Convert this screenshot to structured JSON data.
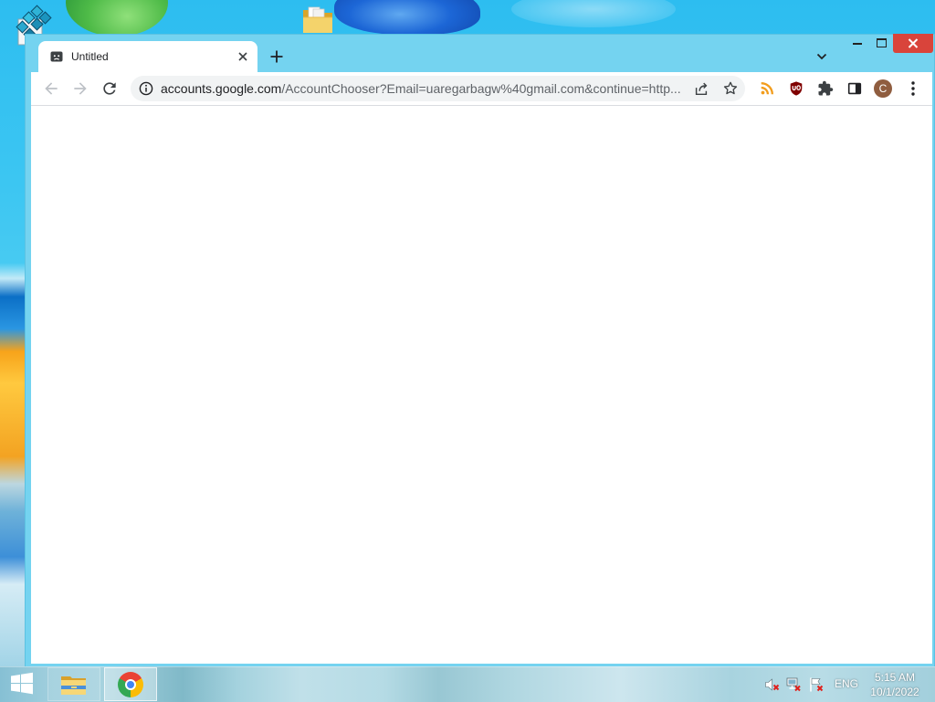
{
  "desktop": {
    "wallpaper_color": "#33c3f1",
    "icons": [
      {
        "icon": "registry-editor-icon"
      },
      {
        "icon": "folder-icon"
      }
    ]
  },
  "browser": {
    "frame_color": "#74d3f0",
    "tab": {
      "title": "Untitled",
      "favicon": "sad-page-icon",
      "close_icon": "close-icon"
    },
    "new_tab_icon": "plus-icon",
    "tab_search_icon": "chevron-down-icon",
    "window_controls": {
      "minimize_icon": "minimize-icon",
      "maximize_icon": "maximize-icon",
      "close_icon": "close-icon",
      "close_color": "#d9443b"
    },
    "toolbar": {
      "back_icon": "arrow-left-icon",
      "forward_icon": "arrow-right-icon",
      "reload_icon": "reload-icon",
      "omnibox": {
        "site_info_icon": "info-icon",
        "url_host": "accounts.google.com",
        "url_path": "/AccountChooser?Email=uaregarbagw%40gmail.com&continue=http...",
        "share_icon": "share-icon",
        "bookmark_icon": "star-icon",
        "background": "#f1f3f4"
      },
      "extensions": [
        {
          "icon": "rss-feed-icon",
          "color": "#f29d1d"
        },
        {
          "icon": "ublock-origin-icon",
          "color": "#800000"
        },
        {
          "icon": "puzzle-icon"
        }
      ],
      "side_panel_icon": "side-panel-icon",
      "profile": {
        "initial": "C",
        "color": "#8f5d3f"
      },
      "menu_icon": "kebab-menu-icon"
    },
    "page": {
      "background": "#ffffff"
    }
  },
  "taskbar": {
    "start_icon": "windows-logo-icon",
    "pinned": [
      {
        "icon": "file-explorer-icon"
      },
      {
        "icon": "chrome-icon",
        "active": true
      }
    ],
    "tray": {
      "icons": [
        "volume-muted-icon",
        "network-disconnected-icon",
        "action-center-flag-icon"
      ],
      "language": "ENG",
      "time": "5:15 AM",
      "date": "10/1/2022"
    }
  }
}
